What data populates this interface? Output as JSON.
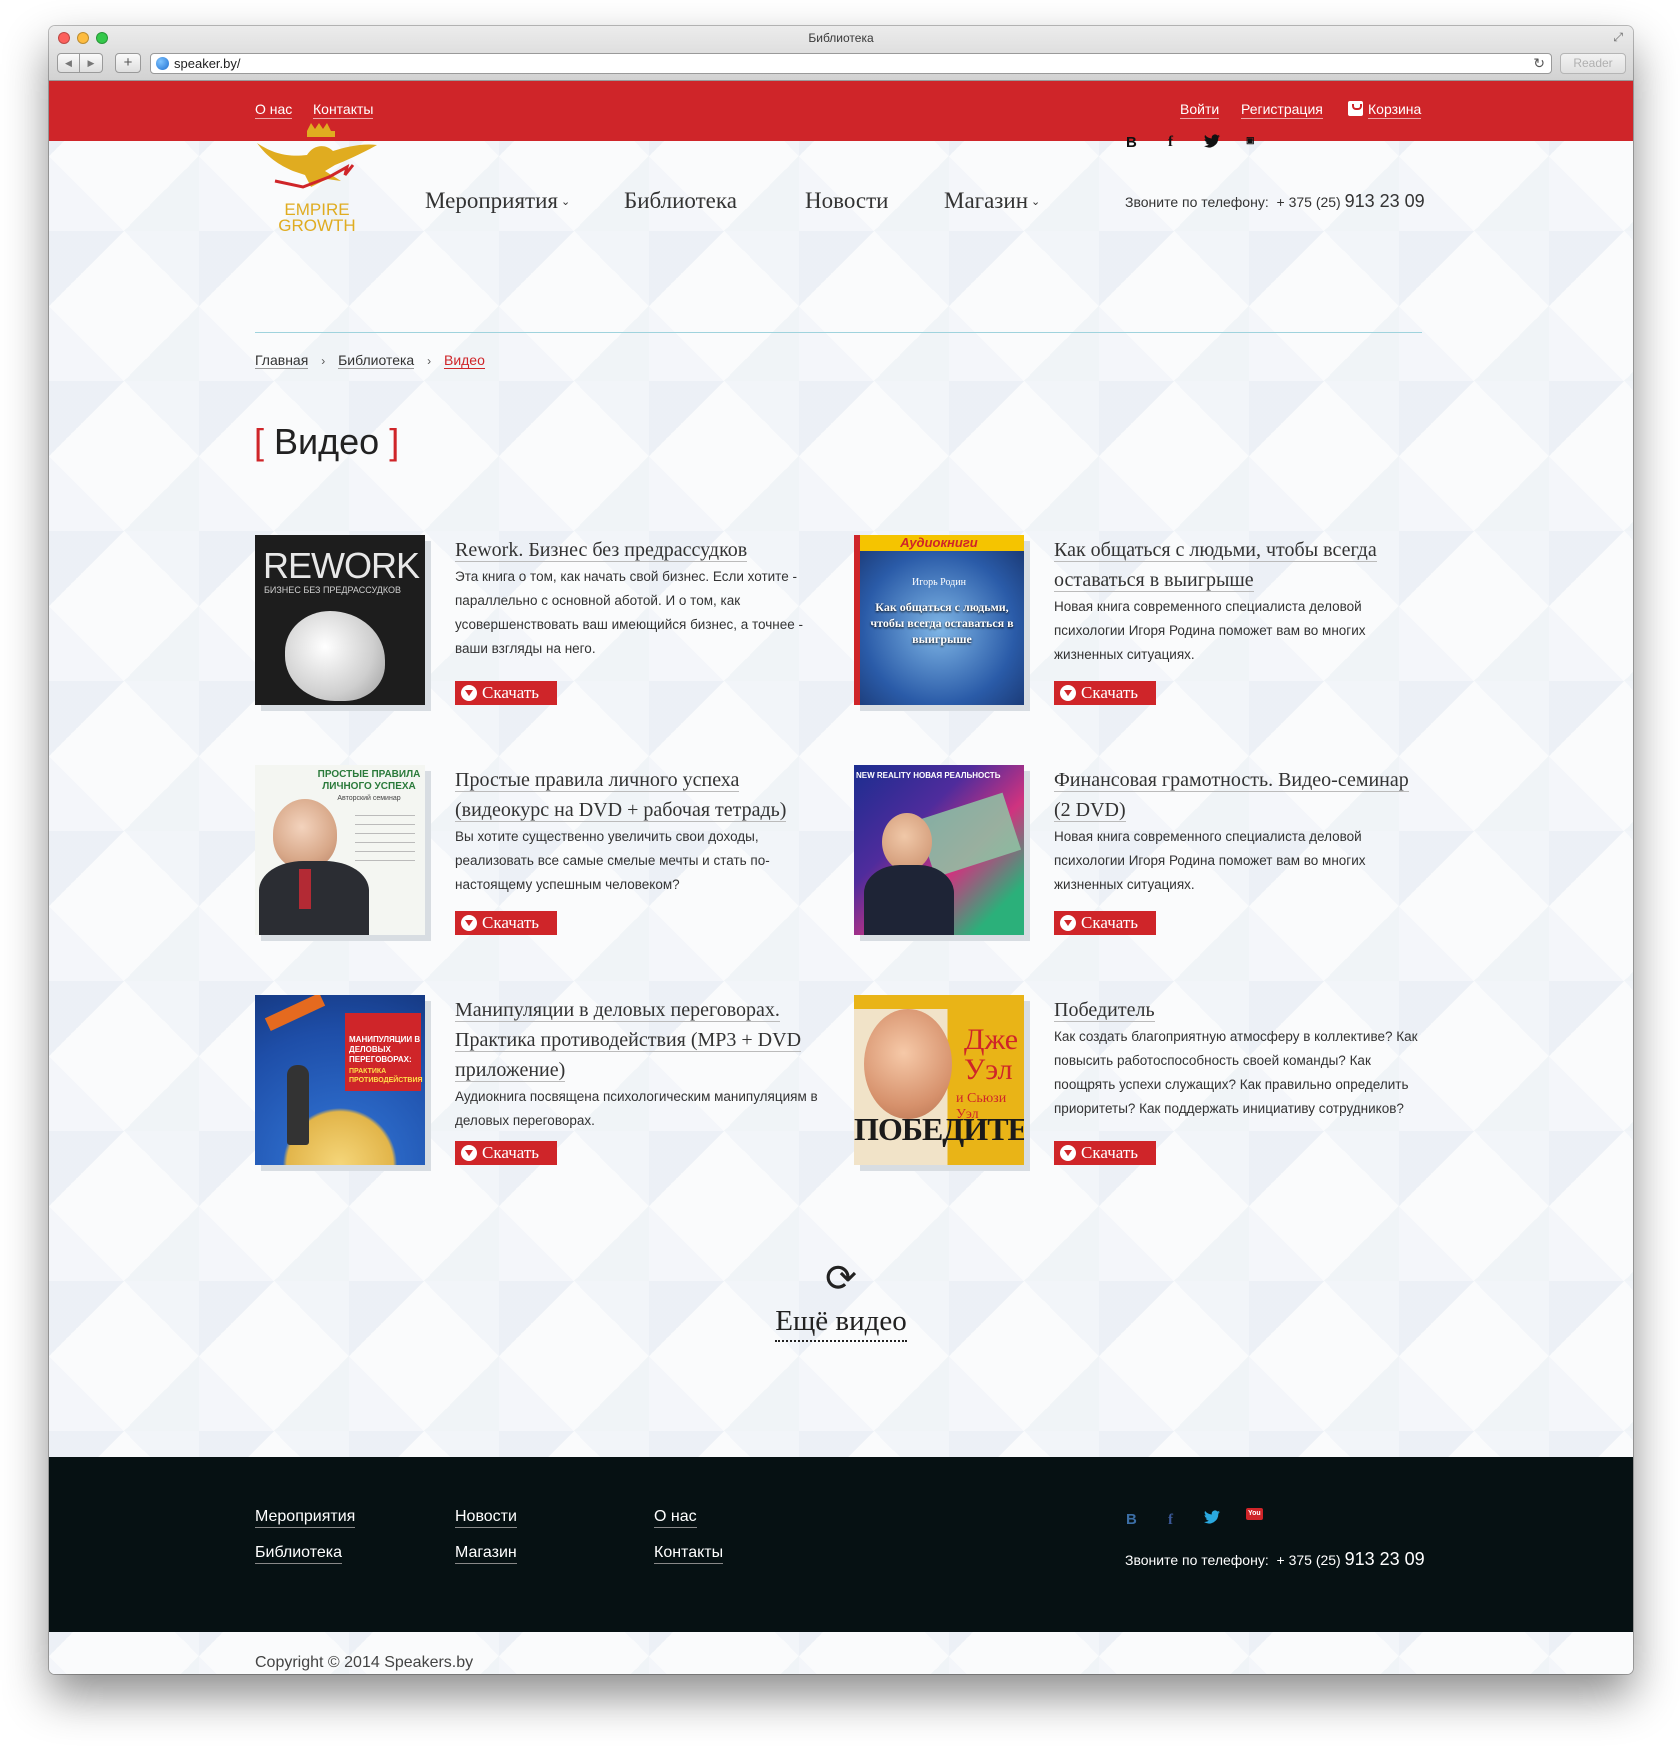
{
  "browser": {
    "window_title": "Библиотека",
    "url": "speaker.by/",
    "reader_label": "Reader"
  },
  "topbar": {
    "left_links": [
      "О нас",
      "Контакты"
    ],
    "login": "Войти",
    "register": "Регистрация",
    "cart": "Корзина"
  },
  "logo": {
    "line1": "EMPIRE",
    "line2": "GROWTH"
  },
  "nav": {
    "items": [
      "Мероприятия",
      "Библиотека",
      "Новости",
      "Магазин"
    ]
  },
  "social": {
    "vk": "В",
    "facebook": "f",
    "twitter": "t",
    "youtube": "You"
  },
  "phone": {
    "label": "Звоните по телефону:",
    "prefix": "+ 375 (25)",
    "number": "913 23 09"
  },
  "breadcrumb": {
    "home": "Главная",
    "library": "Библиотека",
    "current": "Видео"
  },
  "page_title": {
    "open": "[",
    "text": "Видео",
    "close": "]"
  },
  "items": [
    {
      "title": "Rework. Бизнес без предрассудков",
      "description": "Эта книга о том, как начать свой бизнес. Если хотите - параллельно с основной аботой. И о том, как усовершенствовать ваш имеющийся бизнес, а точнее - ваши взгляды на него.",
      "cover_title": "REWORK",
      "cover_subtitle": "БИЗНЕС БЕЗ ПРЕДРАССУДКОВ",
      "button": "Скачать"
    },
    {
      "title": "Как общаться с людьми, чтобы всегда оставаться в выигрыше",
      "description": "Новая книга современного специалиста деловой психологии Игоря Родина поможет вам во многих жизненных ситуациях.",
      "cover_badge": "Аудиокниги",
      "cover_author": "Игорь Родин",
      "cover_text": "Как общаться с людьми, чтобы всегда оставаться в выигрыше",
      "button": "Скачать"
    },
    {
      "title": "Простые правила личного успеха (видеокурс на DVD + рабочая тетрадь)",
      "description": "Вы хотите существенно увеличить свои доходы, реализовать все самые смелые мечты и стать по-настоящему успешным человеком?",
      "cover_title": "ПРОСТЫЕ ПРАВИЛА ЛИЧНОГО УСПЕХА",
      "cover_subtitle": "Авторский семинар",
      "button": "Скачать"
    },
    {
      "title": "Финансовая грамотность. Видео-семинар (2 DVD)",
      "description": "Новая книга современного специалиста деловой психологии Игоря Родина поможет вам во многих жизненных ситуациях.",
      "cover_title": "NEW REALITY НОВАЯ РЕАЛЬНОСТЬ",
      "button": "Скачать"
    },
    {
      "title": "Манипуляции в деловых переговорах. Практика противодействия (MP3 + DVD приложение)",
      "description": "Аудиокнига посвящена психологическим манипуляциям в деловых переговорах.",
      "cover_title": "МАНИПУЛЯЦИИ В ДЕЛОВЫХ ПЕРЕГОВОРАХ:",
      "cover_subtitle": "ПРАКТИКА ПРОТИВОДЕЙСТВИЯ",
      "button": "Скачать"
    },
    {
      "title": "Победитель",
      "description": "Как создать благоприятную атмосферу в коллективе? Как повысить работоспособность своей команды? Как поощрять успехи служащих? Как правильно определить приоритеты? Как поддержать инициативу сотрудников?",
      "cover_name": "Дже Уэл",
      "cover_sub": "и Сьюзи Уэл",
      "cover_title": "ПОБЕДИТЕЛ",
      "button": "Скачать"
    }
  ],
  "more": {
    "label": "Ещё видео"
  },
  "footer": {
    "col1": [
      "Мероприятия",
      "Библиотека"
    ],
    "col2": [
      "Новости",
      "Магазин"
    ],
    "col3": [
      "О нас",
      "Контакты"
    ],
    "phone_label": "Звоните по телефону:",
    "phone_prefix": "+ 375 (25)",
    "phone_number": "913 23 09"
  },
  "copyright": "Copyright © 2014 Speakers.by",
  "colors": {
    "accent": "#cf2529",
    "footer_bg": "#061113",
    "divider": "#9fd3dd"
  }
}
